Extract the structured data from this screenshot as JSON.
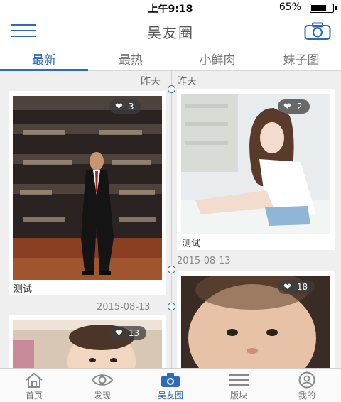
{
  "status_bar": {
    "time": "上午9:18",
    "battery": "65%",
    "battery_level": 0.65
  },
  "nav": {
    "title": "吴友圈"
  },
  "tabs": [
    {
      "label": "最新"
    },
    {
      "label": "最热"
    },
    {
      "label": "小鲜肉"
    },
    {
      "label": "妹子图"
    }
  ],
  "feed": {
    "left": {
      "day": "昨天",
      "post1": {
        "likes": "3",
        "caption": "测试"
      },
      "date": "2015-08-13",
      "post2": {
        "likes": "13"
      }
    },
    "right": {
      "day": "昨天",
      "post1": {
        "likes": "2",
        "caption": "测试"
      },
      "date": "2015-08-13",
      "post2": {
        "likes": "18"
      }
    }
  },
  "bottom_tabs": [
    {
      "label": "首页",
      "icon": "home-icon"
    },
    {
      "label": "发现",
      "icon": "eye-icon"
    },
    {
      "label": "吴友圈",
      "icon": "camera-icon"
    },
    {
      "label": "版块",
      "icon": "list-icon"
    },
    {
      "label": "我的",
      "icon": "user-icon"
    }
  ],
  "colors": {
    "accent": "#2f6bb4"
  }
}
